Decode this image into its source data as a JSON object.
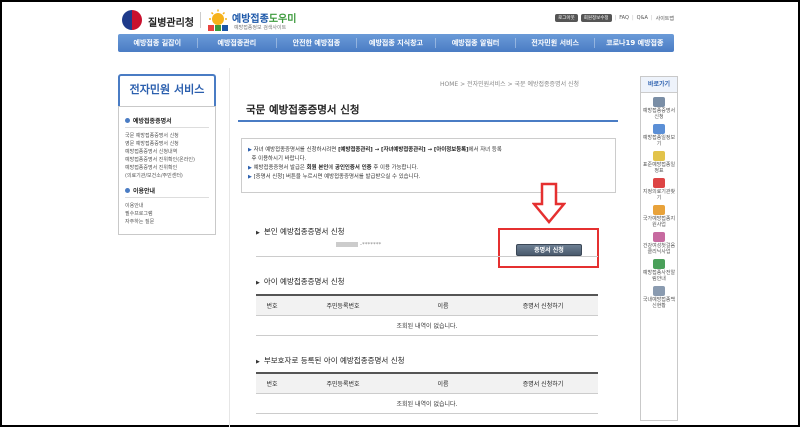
{
  "header": {
    "org_name": "질병관리청",
    "site_title_part1": "예방접종",
    "site_title_part2": "도우미",
    "site_sub": "예방접종정보 검색사이트",
    "util_links": [
      "로그아웃",
      "회원정보수정",
      "FAQ",
      "Q&A",
      "사이트맵"
    ]
  },
  "gnb": [
    "예방접종 길잡이",
    "예방접종관리",
    "안전한 예방접종",
    "예방접종 지식창고",
    "예방접종 알림터",
    "전자민원 서비스",
    "코로나19 예방접종"
  ],
  "left": {
    "title": "전자민원 서비스",
    "group1_head": "예방접종증명서",
    "group1_links": [
      "국문 예방접종증명서 신청",
      "영문 예방접종증명서 신청",
      "예방접종증명서 신청내역",
      "예방접종증명서 진위확인(온라인)",
      "예방접종증명서 진위확인",
      "(의료기관/보건소/주민센터)"
    ],
    "group2_head": "이용안내",
    "group2_links": [
      "이용안내",
      "필수프로그램",
      "자주하는 질문"
    ]
  },
  "breadcrumb": "HOME > 전자민원서비스 > 국문 예방접종증명서 신청",
  "page_title": "국문 예방접종증명서 신청",
  "notice": {
    "line1a": "자녀 예방접종증명서를 신청하시려면 ",
    "line1b": "[예방접종관리] → [자녀예방접종관리] → [아이정보등록]",
    "line1c": "에서 자녀 등록",
    "line1d": "후 이용하시기 바랍니다.",
    "line2a": "예방접종증명서 발급은 ",
    "line2b": "회원 본인",
    "line2c": "에 ",
    "line2d": "공인인증서 인증",
    "line2e": " 후 이용 가능합니다.",
    "line3": "[증명서 신청] 버튼을 누르시면 예방접종증명서를 발급받으실 수 있습니다."
  },
  "self_section": {
    "title": "본인 예방접종증명서 신청",
    "masked_id": "-*******",
    "button_label": "증명서 신청"
  },
  "child_section": {
    "title": "아이 예방접종증명서 신청",
    "columns": [
      "번호",
      "주민등록번호",
      "이름",
      "증명서 신청하기"
    ],
    "empty_text": "조회된 내역이 없습니다."
  },
  "guardian_section": {
    "title": "부보호자로 등록된 아이 예방접종증명서 신청",
    "columns": [
      "번호",
      "주민등록번호",
      "이름",
      "증명서 신청하기"
    ],
    "empty_text": "조회된 내역이 없습니다."
  },
  "quick": {
    "title": "바로가기",
    "items": [
      "예방접종증명서 신청",
      "예방접종일정보기",
      "표준예방접종일정표",
      "지정의료기관찾기",
      "국가예방접종지원사업",
      "건강여성첫걸음클리닉사업",
      "예방접종사전알림안내",
      "국내예방접종백신현황"
    ]
  }
}
